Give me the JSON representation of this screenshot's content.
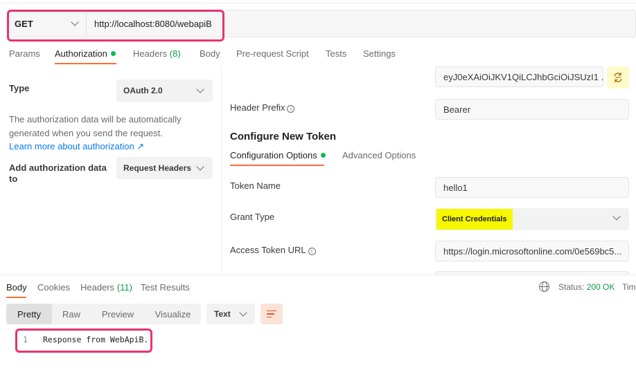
{
  "request": {
    "method": "GET",
    "url": "http://localhost:8080/webapiB"
  },
  "request_tabs": [
    {
      "label": "Params"
    },
    {
      "label": "Authorization"
    },
    {
      "label": "Headers",
      "count": "(8)"
    },
    {
      "label": "Body"
    },
    {
      "label": "Pre-request Script"
    },
    {
      "label": "Tests"
    },
    {
      "label": "Settings"
    }
  ],
  "auth": {
    "type_label": "Type",
    "type_value": "OAuth 2.0",
    "description": "The authorization data will be automatically generated when you send the request.",
    "learn_more": "Learn more about authorization ↗",
    "add_to_label": "Add authorization data to",
    "add_to_value": "Request Headers"
  },
  "config": {
    "access_token_value": "eyJ0eXAiOiJKV1QiLCJhbGciOiJSUzI1 ...",
    "header_prefix_label": "Header Prefix",
    "header_prefix_value": "Bearer",
    "section_title": "Configure New Token",
    "tabs": [
      {
        "label": "Configuration Options"
      },
      {
        "label": "Advanced Options"
      }
    ],
    "token_name_label": "Token Name",
    "token_name_value": "hello1",
    "grant_type_label": "Grant Type",
    "grant_type_value": "Client Credentials",
    "access_token_url_label": "Access Token URL",
    "access_token_url_value": "https://login.microsoftonline.com/0e569bc5..."
  },
  "response": {
    "tabs": [
      {
        "label": "Body"
      },
      {
        "label": "Cookies"
      },
      {
        "label": "Headers",
        "count": "(11)"
      },
      {
        "label": "Test Results"
      }
    ],
    "status_label": "Status:",
    "status_value": "200 OK",
    "time_label": "Tim",
    "view_modes": [
      "Pretty",
      "Raw",
      "Preview",
      "Visualize"
    ],
    "format": "Text",
    "line_number": "1",
    "body": "Response from WebApiB."
  },
  "colors": {
    "accent": "#ff6c37",
    "highlight_box": "#e8336d",
    "status_ok": "#0c9b45",
    "link": "#097bed",
    "grant_highlight": "#f7f700"
  }
}
